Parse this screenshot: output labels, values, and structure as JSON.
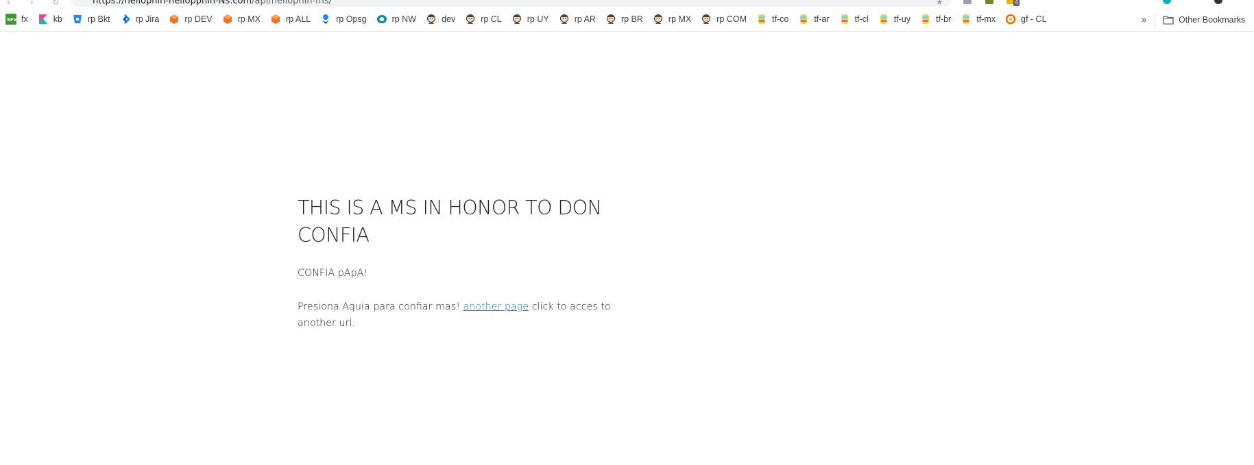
{
  "browser": {
    "address_host": "https://hellophin-hellopphin-Ns.com",
    "address_path": "/api/hellophin-ms/",
    "badge_count": "4"
  },
  "bookmarks": [
    {
      "label": "fx",
      "icon": "sfx-logo-icon",
      "color": "#3a9a2a"
    },
    {
      "label": "kb",
      "icon": "kibana-icon",
      "color": "#e8488b"
    },
    {
      "label": "rp Bkt",
      "icon": "bitbucket-icon",
      "color": "#2684ff"
    },
    {
      "label": "rp Jira",
      "icon": "jira-icon",
      "color": "#2684ff"
    },
    {
      "label": "rp DEV",
      "icon": "orange-hexagon-icon",
      "color": "#f0731c"
    },
    {
      "label": "rp MX",
      "icon": "orange-hexagon-icon",
      "color": "#f0731c"
    },
    {
      "label": "rp ALL",
      "icon": "orange-hexagon-icon",
      "color": "#f0731c"
    },
    {
      "label": "rp Opsg",
      "icon": "opsgenie-icon",
      "color": "#2684ff"
    },
    {
      "label": "rp NW",
      "icon": "newrelic-icon",
      "color": "#008c99"
    },
    {
      "label": "dev",
      "icon": "jenkins-icon",
      "color": "#8b6f5c"
    },
    {
      "label": "rp CL",
      "icon": "jenkins-icon",
      "color": "#8b6f5c"
    },
    {
      "label": "rp UY",
      "icon": "jenkins-icon",
      "color": "#8b6f5c"
    },
    {
      "label": "rp AR",
      "icon": "jenkins-icon",
      "color": "#8b6f5c"
    },
    {
      "label": "rp BR",
      "icon": "jenkins-icon",
      "color": "#8b6f5c"
    },
    {
      "label": "rp MX",
      "icon": "jenkins-icon",
      "color": "#8b6f5c"
    },
    {
      "label": "rp COM",
      "icon": "jenkins-icon",
      "color": "#8b6f5c"
    },
    {
      "label": "tf-co",
      "icon": "teamcity-icon",
      "color": "#d4a017"
    },
    {
      "label": "tf-ar",
      "icon": "teamcity-icon",
      "color": "#d4a017"
    },
    {
      "label": "tf-cl",
      "icon": "teamcity-icon",
      "color": "#d4a017"
    },
    {
      "label": "tf-uy",
      "icon": "teamcity-icon",
      "color": "#d4a017"
    },
    {
      "label": "tf-br",
      "icon": "teamcity-icon",
      "color": "#d4a017"
    },
    {
      "label": "tf-mx",
      "icon": "teamcity-icon",
      "color": "#d4a017"
    },
    {
      "label": "gf - CL",
      "icon": "grafana-icon",
      "color": "#f46800"
    }
  ],
  "bookmarks_more": "»",
  "other_bookmarks": "Other Bookmarks",
  "page": {
    "title": "THIS IS A MS IN HONOR TO DON CONFIA",
    "line1": "CONFIA pApA!",
    "line2_before": "Presiona Aquia para confiar mas! ",
    "link_text": "another page",
    "line2_after": " click to acces to another url."
  },
  "colors": {
    "link": "#1a8bb3",
    "text": "#222222"
  }
}
